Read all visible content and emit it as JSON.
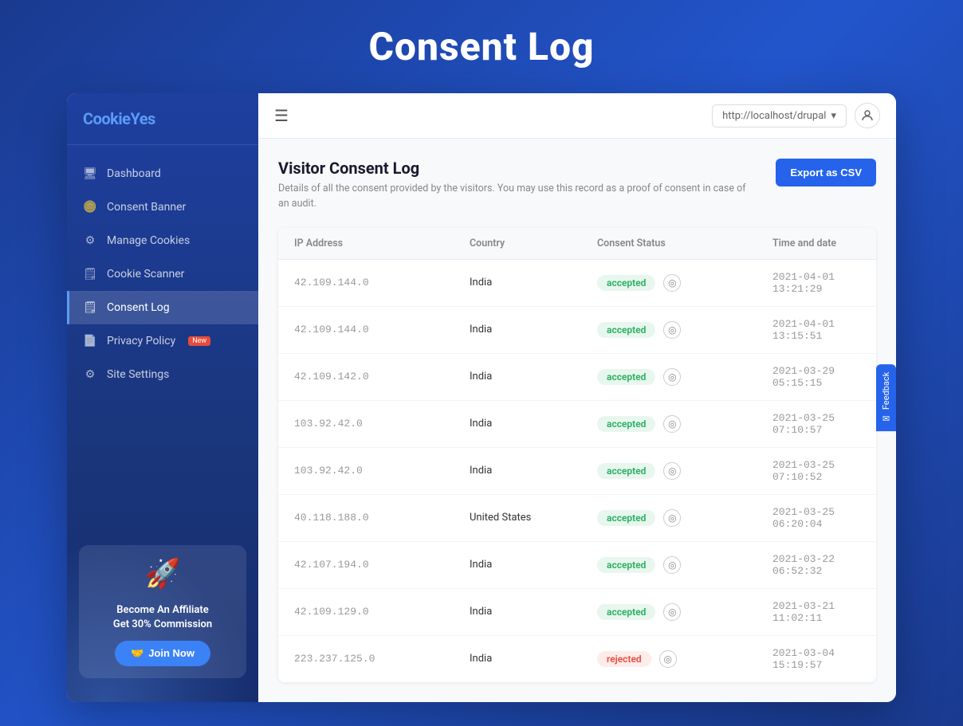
{
  "page": {
    "title": "Consent Log"
  },
  "header": {
    "domain": "http://localhost/drupal",
    "hamburger": "☰"
  },
  "sidebar": {
    "logo": "CookieYes",
    "nav_items": [
      {
        "id": "dashboard",
        "label": "Dashboard",
        "icon": "🖥"
      },
      {
        "id": "consent-banner",
        "label": "Consent Banner",
        "icon": "🪙"
      },
      {
        "id": "manage-cookies",
        "label": "Manage Cookies",
        "icon": "⚙"
      },
      {
        "id": "cookie-scanner",
        "label": "Cookie Scanner",
        "icon": "🗒"
      },
      {
        "id": "consent-log",
        "label": "Consent Log",
        "icon": "🗒",
        "active": true
      },
      {
        "id": "privacy-policy",
        "label": "Privacy Policy",
        "icon": "📄",
        "badge": "New"
      },
      {
        "id": "site-settings",
        "label": "Site Settings",
        "icon": "⚙"
      }
    ],
    "affiliate": {
      "title": "Become An Affiliate\nGet 30% Commission",
      "join_label": "Join Now",
      "emoji": "🚀"
    }
  },
  "consent_log": {
    "page_title": "Visitor Consent Log",
    "description": "Details of all the consent provided by the visitors. You may use this record as a proof of consent in case of an audit.",
    "export_btn": "Export as CSV",
    "table": {
      "columns": [
        "IP Address",
        "Country",
        "Consent Status",
        "Time and date"
      ],
      "rows": [
        {
          "ip": "42.109.144.0",
          "country": "India",
          "status": "accepted",
          "date": "2021-04-01 13:21:29"
        },
        {
          "ip": "42.109.144.0",
          "country": "India",
          "status": "accepted",
          "date": "2021-04-01 13:15:51"
        },
        {
          "ip": "42.109.142.0",
          "country": "India",
          "status": "accepted",
          "date": "2021-03-29 05:15:15"
        },
        {
          "ip": "103.92.42.0",
          "country": "India",
          "status": "accepted",
          "date": "2021-03-25 07:10:57"
        },
        {
          "ip": "103.92.42.0",
          "country": "India",
          "status": "accepted",
          "date": "2021-03-25 07:10:52"
        },
        {
          "ip": "40.118.188.0",
          "country": "United States",
          "status": "accepted",
          "date": "2021-03-25 06:20:04"
        },
        {
          "ip": "42.107.194.0",
          "country": "India",
          "status": "accepted",
          "date": "2021-03-22 06:52:32"
        },
        {
          "ip": "42.109.129.0",
          "country": "India",
          "status": "accepted",
          "date": "2021-03-21 11:02:11"
        },
        {
          "ip": "223.237.125.0",
          "country": "India",
          "status": "rejected",
          "date": "2021-03-04 15:19:57"
        }
      ]
    }
  },
  "feedback": {
    "label": "Feedback"
  }
}
